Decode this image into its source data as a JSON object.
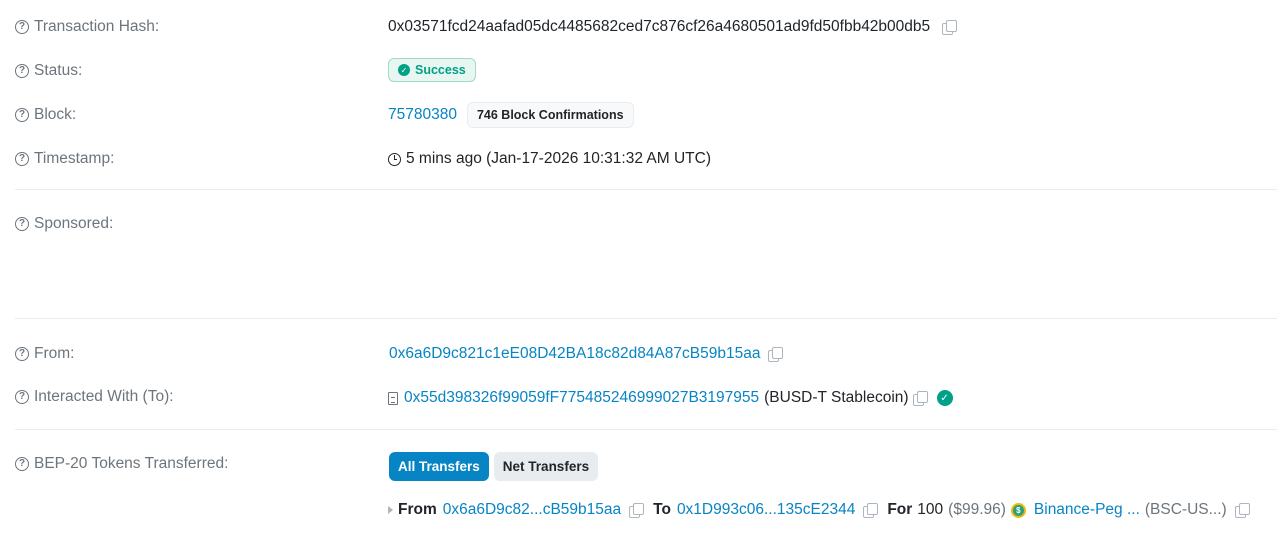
{
  "rows": {
    "tx_hash": {
      "label": "Transaction Hash:",
      "value": "0x03571fcd24aafad05dc4485682ced7c876cf26a4680501ad9fd50fbb42b00db5"
    },
    "status": {
      "label": "Status:",
      "value": "Success"
    },
    "block": {
      "label": "Block:",
      "value": "75780380",
      "confirmations": "746 Block Confirmations"
    },
    "timestamp": {
      "label": "Timestamp:",
      "value": "5 mins ago (Jan-17-2026 10:31:32 AM UTC)"
    },
    "sponsored": {
      "label": "Sponsored:"
    },
    "from": {
      "label": "From:",
      "value": "0x6a6D9c821c1eE08D42BA18c82d84A87cB59b15aa"
    },
    "to": {
      "label": "Interacted With (To):",
      "address": "0x55d398326f99059fF775485246999027B3197955",
      "name": "(BUSD-T Stablecoin)"
    },
    "tokens": {
      "label": "BEP-20 Tokens Transferred:",
      "tabs": [
        "All Transfers",
        "Net Transfers"
      ],
      "transfer": {
        "from_label": "From",
        "from": "0x6a6D9c82...cB59b15aa",
        "to_label": "To",
        "to": "0x1D993c06...135cE2344",
        "for_label": "For",
        "amount": "100",
        "usd": "($99.96)",
        "token_name": "Binance-Peg ...",
        "token_symbol": "(BSC-US...)"
      }
    }
  },
  "colors": {
    "link": "#0784c3",
    "success": "#00a186",
    "muted": "#6c757d"
  },
  "icons": [
    "question-circle-icon",
    "copy-icon",
    "check-circle-icon",
    "clock-icon",
    "file-icon",
    "verified-icon",
    "caret-right-icon",
    "usdt-coin-icon"
  ]
}
